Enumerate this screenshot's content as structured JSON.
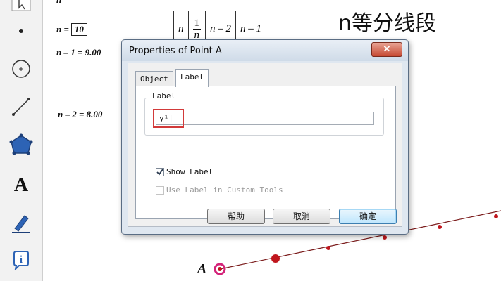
{
  "sketch": {
    "n_symbol": "n",
    "n_eq_label": "n =",
    "n_value": "10",
    "n_minus_1": "n – 1 = 9.00",
    "n_minus_2": "n – 2 = 8.00",
    "title": "n等分线段",
    "point_label": "A",
    "table": {
      "cells": [
        "n",
        "n – 2",
        "n – 1"
      ],
      "frac_num": "1",
      "frac_den": "n"
    }
  },
  "toolbox": {
    "tools": [
      "arrow-select-icon",
      "point-icon",
      "compass-circle-icon",
      "straightedge-icon",
      "polygon-icon",
      "text-icon",
      "marker-icon",
      "info-icon"
    ],
    "text_tool_glyph": "A",
    "info_tool_glyph": "i"
  },
  "dialog": {
    "title": "Properties of Point A",
    "close_glyph": "✕",
    "tabs": [
      "Object",
      "Label"
    ],
    "active_tab": "Label",
    "group_label": "Label",
    "label_input_value": "y¹|",
    "show_label": "Show Label",
    "show_label_checked": true,
    "use_label_custom": "Use Label in Custom Tools",
    "use_label_checked": false,
    "buttons": {
      "help": "帮助",
      "cancel": "取消",
      "ok": "确定"
    }
  },
  "colors": {
    "point": "#c0161d",
    "highlight_ring": "#d4237a",
    "segment": "#7a1a1a",
    "input_highlight": "#d23a3a"
  }
}
